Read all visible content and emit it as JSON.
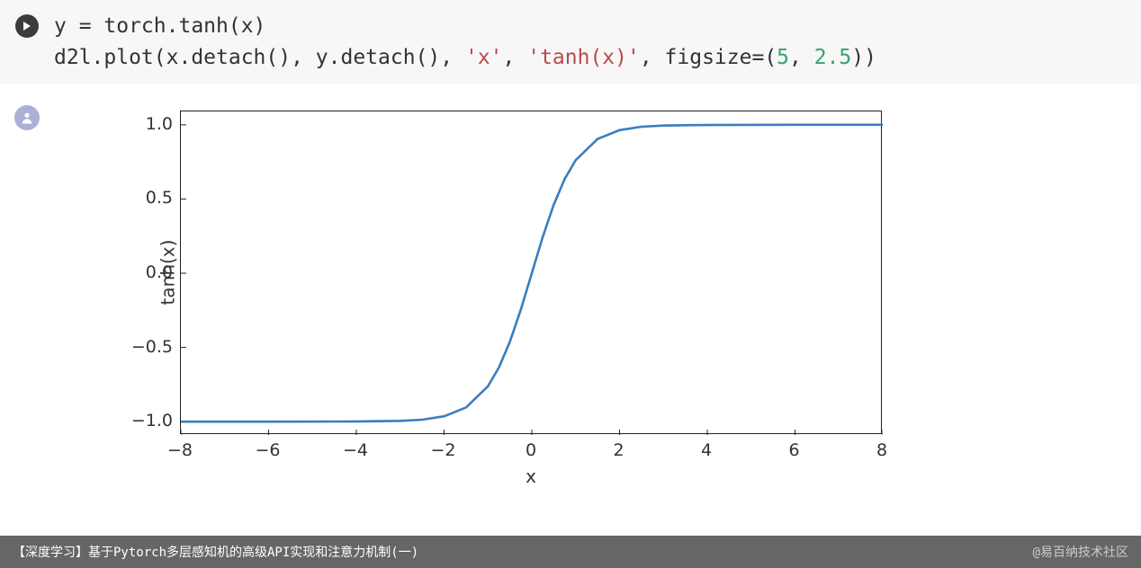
{
  "code": {
    "line1_prefix": "y = torch.tanh(x)",
    "line2_prefix": "d2l.plot(x.detach(), y.detach(), ",
    "str_x": "'x'",
    "comma1": ", ",
    "str_tanhx": "'tanh(x)'",
    "figsize_prefix": ", figsize=(",
    "num5": "5",
    "comma2": ", ",
    "num25": "2.5",
    "close": "))"
  },
  "chart_data": {
    "type": "line",
    "title": "",
    "xlabel": "x",
    "ylabel": "tanh(x)",
    "xlim": [
      -8,
      8
    ],
    "ylim": [
      -1.09,
      1.09
    ],
    "xticks": [
      -8,
      -6,
      -4,
      -2,
      0,
      2,
      4,
      6,
      8
    ],
    "yticks": [
      -1.0,
      -0.5,
      0.0,
      0.5,
      1.0
    ],
    "ytick_labels": [
      "−1.0",
      "−0.5",
      "0.0",
      "0.5",
      "1.0"
    ],
    "xtick_labels": [
      "−8",
      "−6",
      "−4",
      "−2",
      "0",
      "2",
      "4",
      "6",
      "8"
    ],
    "x": [
      -8,
      -6,
      -4,
      -3,
      -2.5,
      -2,
      -1.5,
      -1,
      -0.75,
      -0.5,
      -0.25,
      0,
      0.25,
      0.5,
      0.75,
      1,
      1.5,
      2,
      2.5,
      3,
      4,
      6,
      8
    ],
    "series": [
      {
        "name": "tanh(x)",
        "values": [
          -1.0,
          -1.0,
          -0.999,
          -0.995,
          -0.987,
          -0.964,
          -0.905,
          -0.762,
          -0.635,
          -0.462,
          -0.245,
          0.0,
          0.245,
          0.462,
          0.635,
          0.762,
          0.905,
          0.964,
          0.987,
          0.995,
          0.999,
          1.0,
          1.0
        ],
        "color": "#3b7cc0"
      }
    ]
  },
  "footer": {
    "title": "【深度学习】基于Pytorch多层感知机的高级API实现和注意力机制(一)",
    "watermark": "@易百纳技术社区"
  }
}
